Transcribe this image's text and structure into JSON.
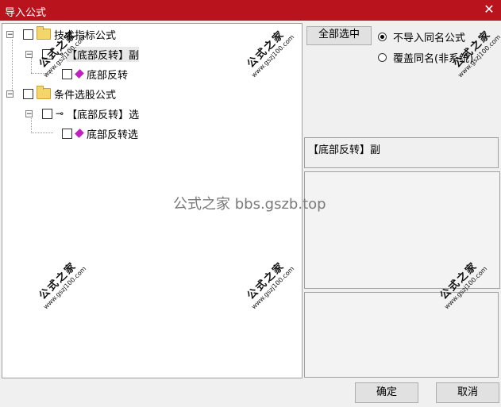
{
  "window": {
    "title": "导入公式",
    "close_glyph": "✕"
  },
  "tree": {
    "nodes": [
      {
        "label": "技术指标公式",
        "icon": "folder-icon"
      },
      {
        "label": "【底部反转】副",
        "icon": "key-icon"
      },
      {
        "label": "底部反转",
        "icon": "gem-icon"
      },
      {
        "label": "条件选股公式",
        "icon": "folder-icon"
      },
      {
        "label": "【底部反转】选",
        "icon": "key-icon"
      },
      {
        "label": "底部反转选",
        "icon": "gem-icon"
      }
    ],
    "expander_glyph": "−"
  },
  "options": {
    "select_all": "全部选中",
    "no_import_same": "不导入同名公式",
    "overwrite_same": "覆盖同名(非系统)"
  },
  "detail": {
    "formula_name": "【底部反转】副"
  },
  "footer": {
    "ok": "确定",
    "cancel": "取消"
  },
  "watermark": {
    "site_mark": "公式之家",
    "site_url": "www.gszj100.com",
    "center_text": "公式之家 bbs.gszb.top"
  },
  "colors": {
    "titlebar": "#b9141e",
    "gem": "#c020c0",
    "folder": "#f3d56a"
  }
}
